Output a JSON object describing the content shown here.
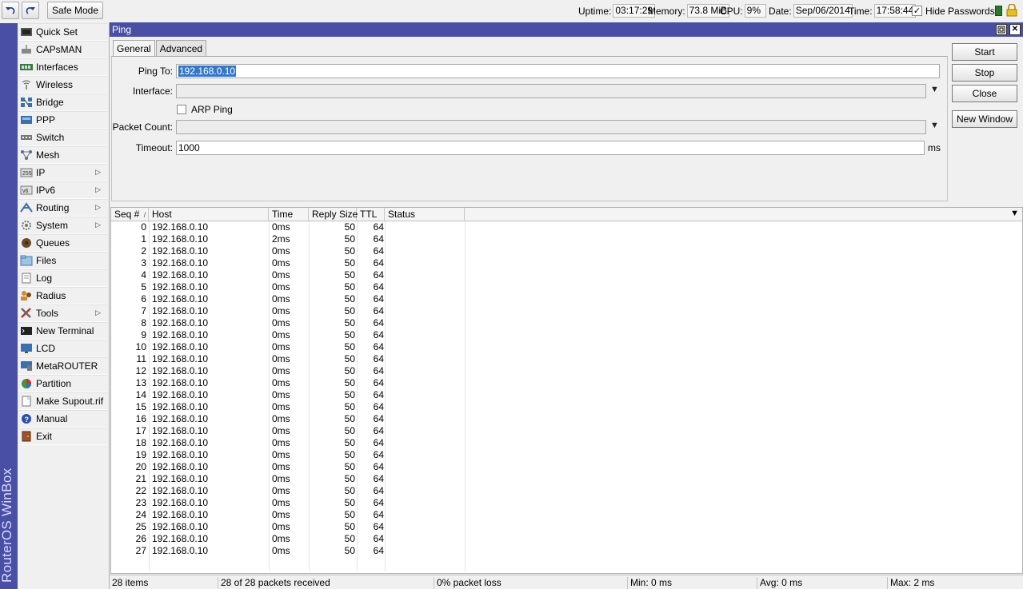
{
  "toolbar": {
    "undo_icon": "undo-icon",
    "redo_icon": "redo-icon",
    "safe_mode": "Safe Mode",
    "uptime_label": "Uptime:",
    "uptime": "03:17:29",
    "memory_label": "Memory:",
    "memory": "73.8 MiB",
    "cpu_label": "CPU:",
    "cpu": "9%",
    "date_label": "Date:",
    "date": "Sep/06/2014",
    "time_label": "Time:",
    "time": "17:58:44",
    "hide_passwords": "Hide Passwords",
    "hide_passwords_checked": true
  },
  "brand": "RouterOS WinBox",
  "sidebar": {
    "items": [
      {
        "label": "Quick Set",
        "icon": "quick-set-icon",
        "submenu": false
      },
      {
        "label": "CAPsMAN",
        "icon": "capsman-icon",
        "submenu": false
      },
      {
        "label": "Interfaces",
        "icon": "interfaces-icon",
        "submenu": false
      },
      {
        "label": "Wireless",
        "icon": "wireless-icon",
        "submenu": false
      },
      {
        "label": "Bridge",
        "icon": "bridge-icon",
        "submenu": false
      },
      {
        "label": "PPP",
        "icon": "ppp-icon",
        "submenu": false
      },
      {
        "label": "Switch",
        "icon": "switch-icon",
        "submenu": false
      },
      {
        "label": "Mesh",
        "icon": "mesh-icon",
        "submenu": false
      },
      {
        "label": "IP",
        "icon": "ip-icon",
        "submenu": true
      },
      {
        "label": "IPv6",
        "icon": "ipv6-icon",
        "submenu": true
      },
      {
        "label": "Routing",
        "icon": "routing-icon",
        "submenu": true
      },
      {
        "label": "System",
        "icon": "system-icon",
        "submenu": true
      },
      {
        "label": "Queues",
        "icon": "queues-icon",
        "submenu": false
      },
      {
        "label": "Files",
        "icon": "files-icon",
        "submenu": false
      },
      {
        "label": "Log",
        "icon": "log-icon",
        "submenu": false
      },
      {
        "label": "Radius",
        "icon": "radius-icon",
        "submenu": false
      },
      {
        "label": "Tools",
        "icon": "tools-icon",
        "submenu": true
      },
      {
        "label": "New Terminal",
        "icon": "terminal-icon",
        "submenu": false
      },
      {
        "label": "LCD",
        "icon": "lcd-icon",
        "submenu": false
      },
      {
        "label": "MetaROUTER",
        "icon": "metarouter-icon",
        "submenu": false
      },
      {
        "label": "Partition",
        "icon": "partition-icon",
        "submenu": false
      },
      {
        "label": "Make Supout.rif",
        "icon": "supout-icon",
        "submenu": false
      },
      {
        "label": "Manual",
        "icon": "manual-icon",
        "submenu": false
      },
      {
        "label": "Exit",
        "icon": "exit-icon",
        "submenu": false
      }
    ]
  },
  "window": {
    "title": "Ping",
    "tabs": [
      {
        "label": "General",
        "active": true
      },
      {
        "label": "Advanced",
        "active": false
      }
    ],
    "form": {
      "ping_to_label": "Ping To:",
      "ping_to_value": "192.168.0.10",
      "interface_label": "Interface:",
      "interface_value": "",
      "arp_ping_label": "ARP Ping",
      "arp_ping_checked": false,
      "packet_count_label": "Packet Count:",
      "packet_count_value": "",
      "timeout_label": "Timeout:",
      "timeout_value": "1000",
      "timeout_unit": "ms"
    },
    "buttons": {
      "start": "Start",
      "stop": "Stop",
      "close": "Close",
      "new_window": "New Window"
    },
    "table": {
      "columns": [
        "Seq #",
        "Host",
        "Time",
        "Reply Size",
        "TTL",
        "Status"
      ],
      "sort_indicator": "/",
      "rows": [
        {
          "seq": "0",
          "host": "192.168.0.10",
          "time": "0ms",
          "size": "50",
          "ttl": "64",
          "status": ""
        },
        {
          "seq": "1",
          "host": "192.168.0.10",
          "time": "2ms",
          "size": "50",
          "ttl": "64",
          "status": ""
        },
        {
          "seq": "2",
          "host": "192.168.0.10",
          "time": "0ms",
          "size": "50",
          "ttl": "64",
          "status": ""
        },
        {
          "seq": "3",
          "host": "192.168.0.10",
          "time": "0ms",
          "size": "50",
          "ttl": "64",
          "status": ""
        },
        {
          "seq": "4",
          "host": "192.168.0.10",
          "time": "0ms",
          "size": "50",
          "ttl": "64",
          "status": ""
        },
        {
          "seq": "5",
          "host": "192.168.0.10",
          "time": "0ms",
          "size": "50",
          "ttl": "64",
          "status": ""
        },
        {
          "seq": "6",
          "host": "192.168.0.10",
          "time": "0ms",
          "size": "50",
          "ttl": "64",
          "status": ""
        },
        {
          "seq": "7",
          "host": "192.168.0.10",
          "time": "0ms",
          "size": "50",
          "ttl": "64",
          "status": ""
        },
        {
          "seq": "8",
          "host": "192.168.0.10",
          "time": "0ms",
          "size": "50",
          "ttl": "64",
          "status": ""
        },
        {
          "seq": "9",
          "host": "192.168.0.10",
          "time": "0ms",
          "size": "50",
          "ttl": "64",
          "status": ""
        },
        {
          "seq": "10",
          "host": "192.168.0.10",
          "time": "0ms",
          "size": "50",
          "ttl": "64",
          "status": ""
        },
        {
          "seq": "11",
          "host": "192.168.0.10",
          "time": "0ms",
          "size": "50",
          "ttl": "64",
          "status": ""
        },
        {
          "seq": "12",
          "host": "192.168.0.10",
          "time": "0ms",
          "size": "50",
          "ttl": "64",
          "status": ""
        },
        {
          "seq": "13",
          "host": "192.168.0.10",
          "time": "0ms",
          "size": "50",
          "ttl": "64",
          "status": ""
        },
        {
          "seq": "14",
          "host": "192.168.0.10",
          "time": "0ms",
          "size": "50",
          "ttl": "64",
          "status": ""
        },
        {
          "seq": "15",
          "host": "192.168.0.10",
          "time": "0ms",
          "size": "50",
          "ttl": "64",
          "status": ""
        },
        {
          "seq": "16",
          "host": "192.168.0.10",
          "time": "0ms",
          "size": "50",
          "ttl": "64",
          "status": ""
        },
        {
          "seq": "17",
          "host": "192.168.0.10",
          "time": "0ms",
          "size": "50",
          "ttl": "64",
          "status": ""
        },
        {
          "seq": "18",
          "host": "192.168.0.10",
          "time": "0ms",
          "size": "50",
          "ttl": "64",
          "status": ""
        },
        {
          "seq": "19",
          "host": "192.168.0.10",
          "time": "0ms",
          "size": "50",
          "ttl": "64",
          "status": ""
        },
        {
          "seq": "20",
          "host": "192.168.0.10",
          "time": "0ms",
          "size": "50",
          "ttl": "64",
          "status": ""
        },
        {
          "seq": "21",
          "host": "192.168.0.10",
          "time": "0ms",
          "size": "50",
          "ttl": "64",
          "status": ""
        },
        {
          "seq": "22",
          "host": "192.168.0.10",
          "time": "0ms",
          "size": "50",
          "ttl": "64",
          "status": ""
        },
        {
          "seq": "23",
          "host": "192.168.0.10",
          "time": "0ms",
          "size": "50",
          "ttl": "64",
          "status": ""
        },
        {
          "seq": "24",
          "host": "192.168.0.10",
          "time": "0ms",
          "size": "50",
          "ttl": "64",
          "status": ""
        },
        {
          "seq": "25",
          "host": "192.168.0.10",
          "time": "0ms",
          "size": "50",
          "ttl": "64",
          "status": ""
        },
        {
          "seq": "26",
          "host": "192.168.0.10",
          "time": "0ms",
          "size": "50",
          "ttl": "64",
          "status": ""
        },
        {
          "seq": "27",
          "host": "192.168.0.10",
          "time": "0ms",
          "size": "50",
          "ttl": "64",
          "status": ""
        }
      ]
    },
    "statusbar": {
      "items": "28 items",
      "received": "28 of 28 packets received",
      "loss": "0% packet loss",
      "min": "Min: 0 ms",
      "avg": "Avg: 0 ms",
      "max": "Max: 2 ms"
    }
  },
  "colors": {
    "accent": "#4a4fa6",
    "selection": "#3377cc"
  }
}
